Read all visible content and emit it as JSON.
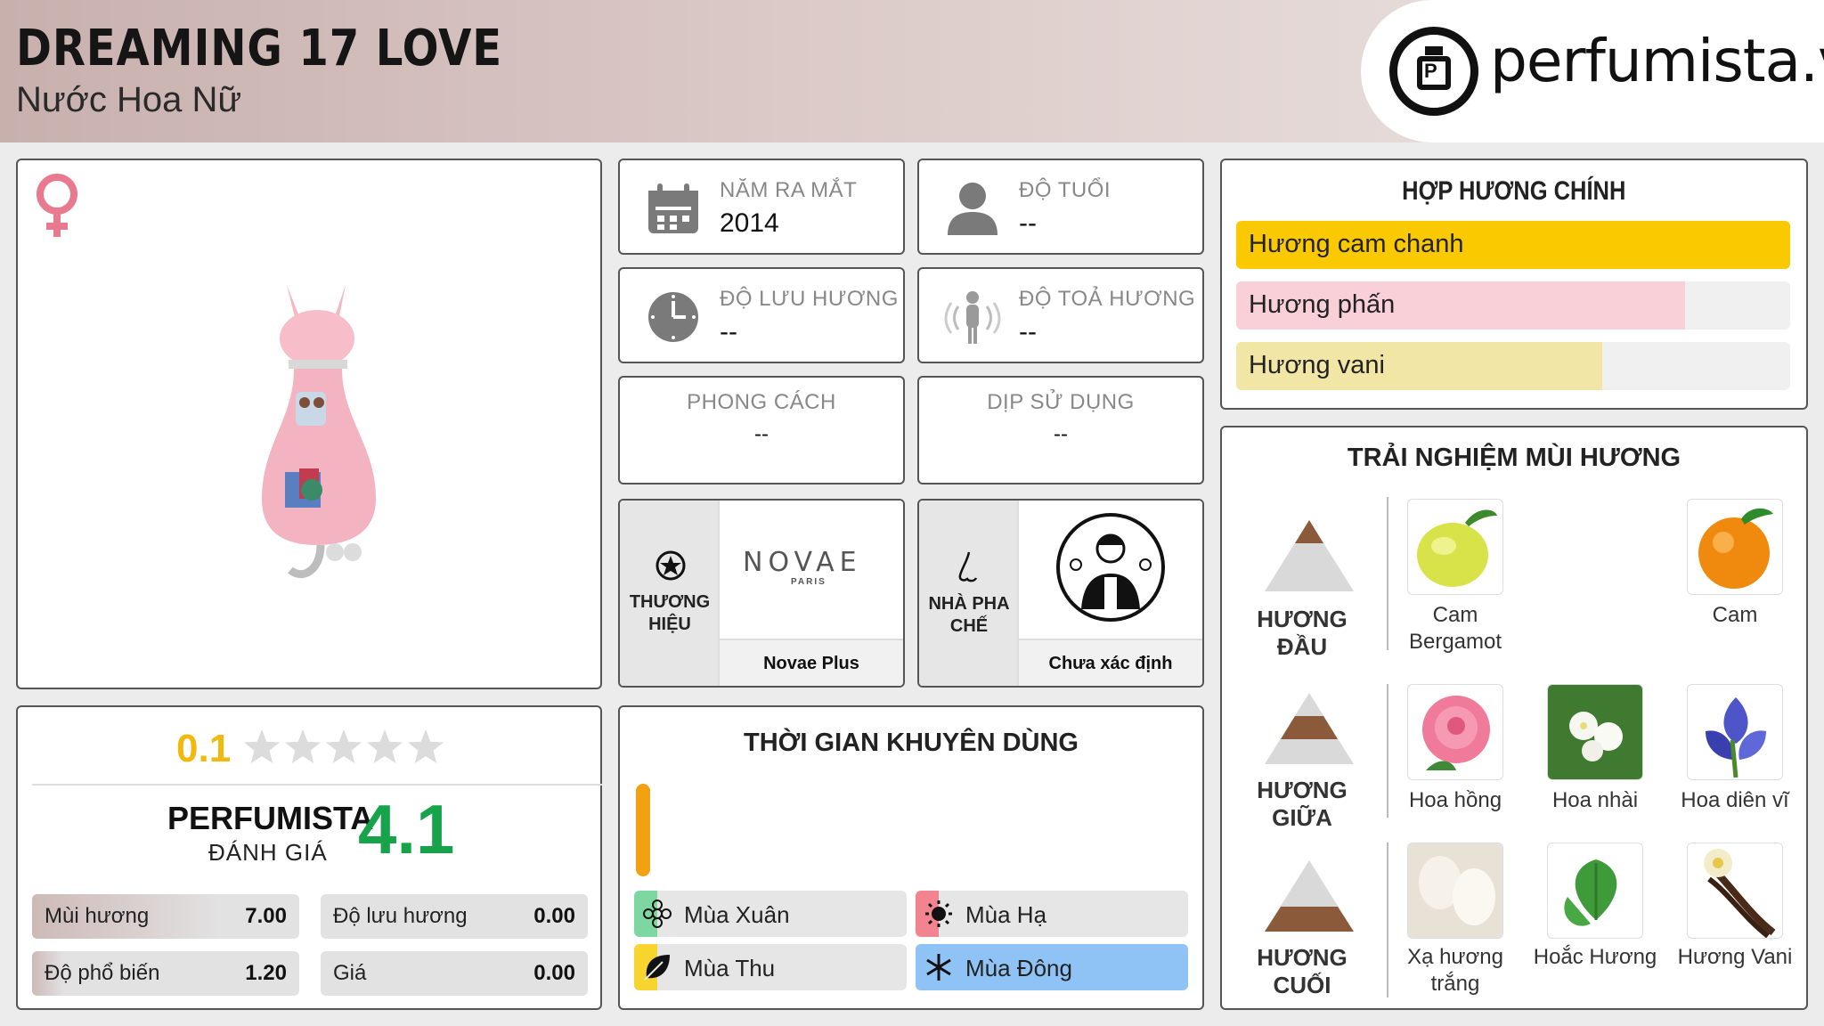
{
  "header": {
    "title": "DREAMING 17 LOVE",
    "subtitle": "Nước Hoa Nữ",
    "logo_text": "perfumista.vn"
  },
  "info": {
    "release_year": {
      "label": "NĂM RA MẮT",
      "value": "2014"
    },
    "age": {
      "label": "ĐỘ TUỔI",
      "value": "--"
    },
    "longevity": {
      "label": "ĐỘ LƯU HƯƠNG",
      "value": "--"
    },
    "sillage": {
      "label": "ĐỘ TOẢ HƯƠNG",
      "value": "--"
    },
    "style": {
      "label": "PHONG CÁCH",
      "value": "--"
    },
    "occasion": {
      "label": "DỊP SỬ DỤNG",
      "value": "--"
    }
  },
  "brand": {
    "label_line1": "THƯƠNG",
    "label_line2": "HIỆU",
    "logo_text": "NOVAE",
    "logo_sub": "PARIS",
    "name": "Novae Plus"
  },
  "perfumer": {
    "label_line1": "NHÀ PHA",
    "label_line2": "CHẾ",
    "name": "Chưa xác định"
  },
  "accords": {
    "title": "HỢP HƯƠNG CHÍNH",
    "items": [
      {
        "label": "Hương cam chanh",
        "percent": 100,
        "color": "#fbc900"
      },
      {
        "label": "Hương phấn",
        "percent": 81,
        "color": "#f9cfd8"
      },
      {
        "label": "Hương vani",
        "percent": 66,
        "color": "#f2e6a6"
      }
    ]
  },
  "notes": {
    "title": "TRẢI NGHIỆM MÙI HƯƠNG",
    "top": {
      "label": "HƯƠNG ĐẦU",
      "items": [
        "Cam Bergamot",
        "Cam"
      ]
    },
    "middle": {
      "label": "HƯƠNG GIỮA",
      "items": [
        "Hoa hồng",
        "Hoa nhài",
        "Hoa diên vĩ"
      ]
    },
    "base": {
      "label": "HƯƠNG CUỐI",
      "items": [
        "Xạ hương trắng",
        "Hoắc Hương",
        "Hương Vani"
      ]
    }
  },
  "rating": {
    "user_score": "0.1",
    "user_stars": 0.1,
    "perfumista_label": "PERFUMISTA",
    "perfumista_sub": "ĐÁNH GIÁ",
    "perfumista_score": "4.1",
    "stats": [
      {
        "label": "Mùi hương",
        "value": "7.00"
      },
      {
        "label": "Độ lưu hương",
        "value": "0.00"
      },
      {
        "label": "Độ phổ biến",
        "value": "1.20"
      },
      {
        "label": "Giá",
        "value": "0.00"
      }
    ]
  },
  "seasons": {
    "title": "THỜI GIAN KHUYÊN DÙNG",
    "items": [
      {
        "label": "Mùa Xuân",
        "color": "#7ed6a0"
      },
      {
        "label": "Mùa Hạ",
        "color": "#f3848f"
      },
      {
        "label": "Mùa Thu",
        "color": "#f8d42f"
      },
      {
        "label": "Mùa Đông",
        "color": "#8fc3f5"
      }
    ]
  },
  "colors": {
    "score_gold": "#f0b90b",
    "score_green": "#16a34a",
    "female_pink": "#e9798f"
  }
}
